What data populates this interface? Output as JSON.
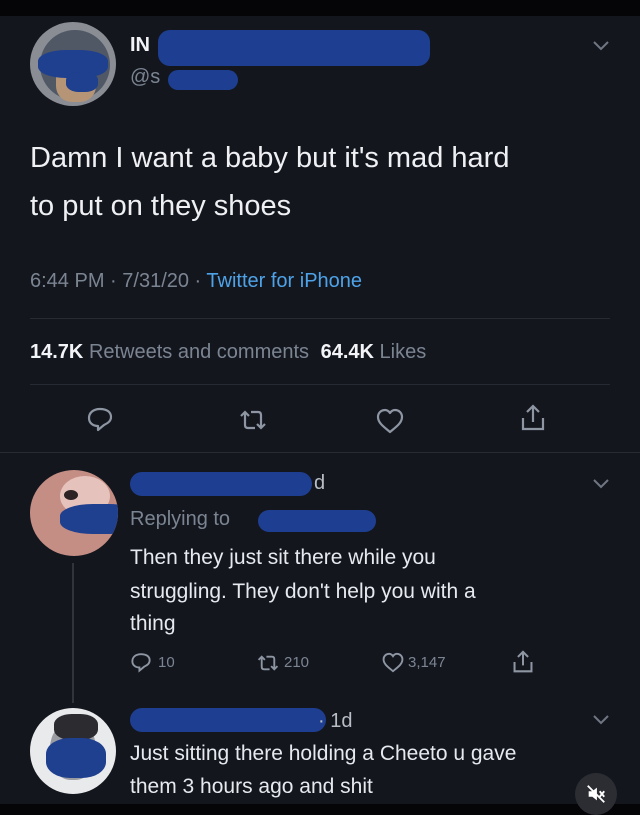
{
  "tweet": {
    "name": "IN",
    "handle": "@s",
    "text_line1": "Damn I want a baby but it's mad hard",
    "text_line2": "to put on they shoes",
    "time": "6:44 PM",
    "date": "7/31/20",
    "client": "Twitter for iPhone",
    "retweets_count": "14.7K",
    "retweets_label": "Retweets and comments",
    "likes_count": "64.4K",
    "likes_label": "Likes"
  },
  "reply1": {
    "name_suffix": "d",
    "replying_to": "Replying to",
    "text_line1": "Then they just sit there while you",
    "text_line2": "struggling. They don't help you with a",
    "text_line3": "thing",
    "reply_count": "10",
    "retweet_count": "210",
    "like_count": "3,147"
  },
  "reply2": {
    "time": "· 1d",
    "text_line1": "Just sitting there holding a Cheeto u gave",
    "text_line2": "them 3 hours ago and shit"
  },
  "icons": [
    "chevron-down-icon",
    "reply-icon",
    "retweet-icon",
    "like-icon",
    "share-icon",
    "mute-icon"
  ],
  "colors": {
    "background": "#14161e",
    "accent": "#1d9bf0",
    "muted": "#7b8592",
    "redaction": "#1e3f91"
  }
}
